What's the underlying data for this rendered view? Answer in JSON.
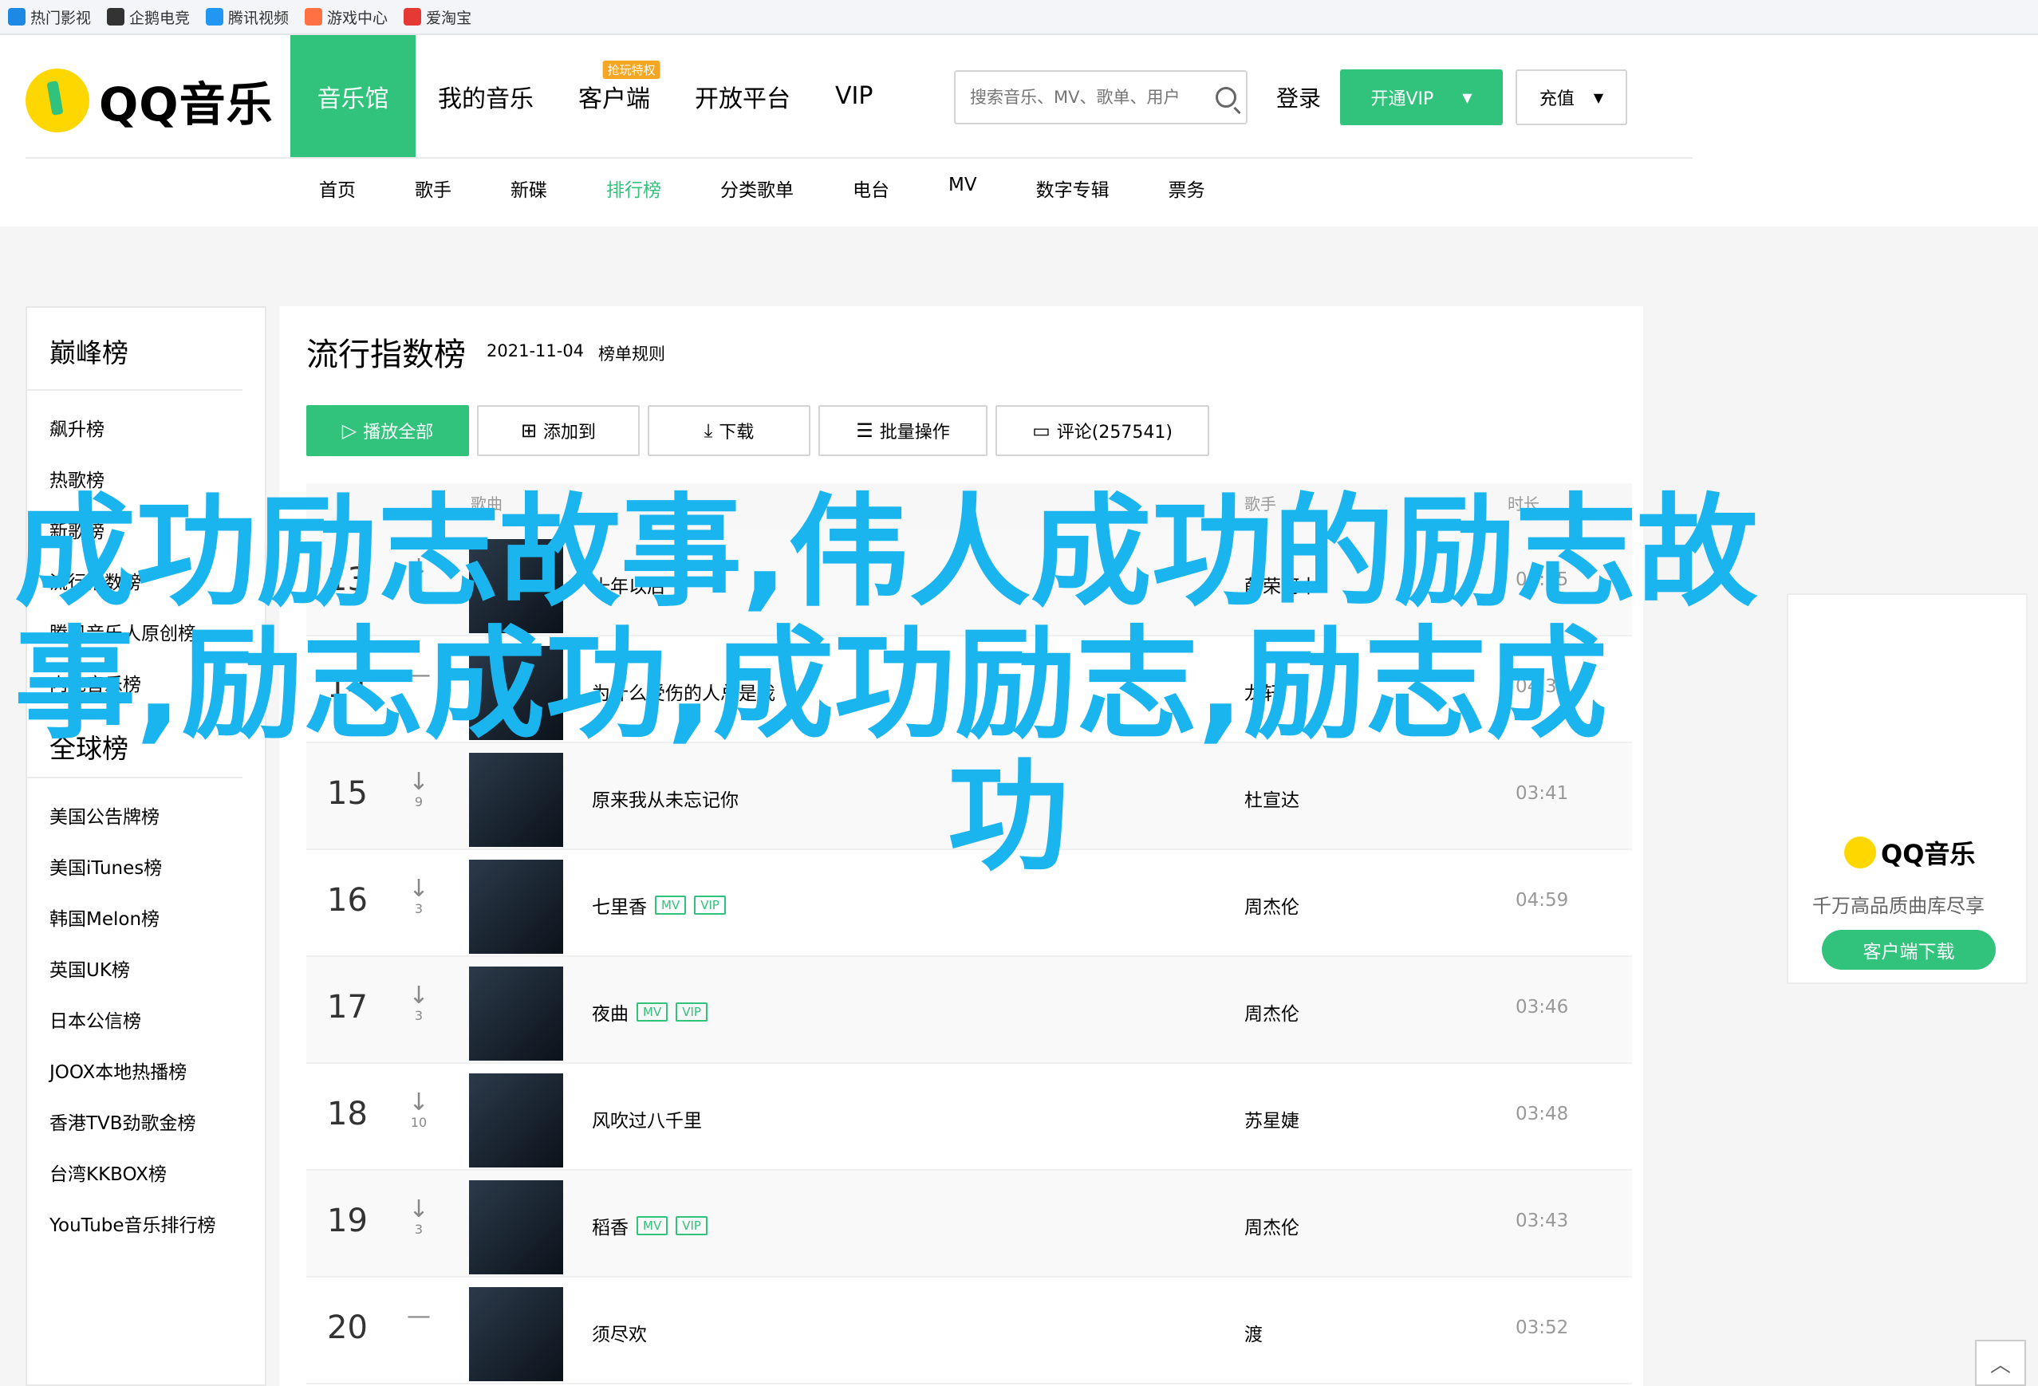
{
  "bookmarks": [
    {
      "label": "热门影视",
      "color": "#1e88e5"
    },
    {
      "label": "企鹅电竞",
      "color": "#333333"
    },
    {
      "label": "腾讯视频",
      "color": "#2196f3"
    },
    {
      "label": "游戏中心",
      "color": "#ff7043"
    },
    {
      "label": "爱淘宝",
      "color": "#e53935"
    }
  ],
  "header": {
    "logo": "QQ音乐",
    "nav": [
      "音乐馆",
      "我的音乐",
      "客户端",
      "开放平台",
      "VIP"
    ],
    "hot_badge": "抢玩特权",
    "search_placeholder": "搜索音乐、MV、歌单、用户",
    "login": "登录",
    "vip_button": "开通VIP",
    "charge_button": "充值",
    "subnav": [
      "首页",
      "歌手",
      "新碟",
      "排行榜",
      "分类歌单",
      "电台",
      "MV",
      "数字专辑",
      "票务"
    ]
  },
  "sidebar": {
    "section1_title": "巅峰榜",
    "section1_items": [
      "飙升榜",
      "热歌榜",
      "新歌榜",
      "流行指数榜",
      "腾讯音乐人原创榜",
      "内地音乐榜"
    ],
    "section2_title": "全球榜",
    "section2_items": [
      "美国公告牌榜",
      "美国iTunes榜",
      "韩国Melon榜",
      "英国UK榜",
      "日本公信榜",
      "JOOX本地热播榜",
      "香港TVB劲歌金榜",
      "台湾KKBOX榜",
      "YouTube音乐排行榜"
    ]
  },
  "main": {
    "title": "流行指数榜",
    "date": "2021-11-04",
    "rule": "榜单规则",
    "toolbar": [
      "播放全部",
      "添加到",
      "下载",
      "批量操作",
      "评论(257541)"
    ],
    "columns": [
      "歌曲",
      "歌手",
      "时长"
    ],
    "rows": [
      {
        "rank": "13",
        "change": "2",
        "song": "十年以后",
        "singer": "薛荣阿木",
        "duration": "05:05",
        "mv": false,
        "vip": false
      },
      {
        "rank": "14",
        "change": "",
        "song": "为什么受伤的人总是我",
        "singer": "龙轩",
        "duration": "04:33",
        "mv": false,
        "vip": false
      },
      {
        "rank": "15",
        "change": "9",
        "song": "原来我从未忘记你",
        "singer": "杜宣达",
        "duration": "03:41",
        "mv": false,
        "vip": false
      },
      {
        "rank": "16",
        "change": "3",
        "song": "七里香",
        "singer": "周杰伦",
        "duration": "04:59",
        "mv": true,
        "vip": true
      },
      {
        "rank": "17",
        "change": "3",
        "song": "夜曲",
        "singer": "周杰伦",
        "duration": "03:46",
        "mv": true,
        "vip": true
      },
      {
        "rank": "18",
        "change": "10",
        "song": "风吹过八千里",
        "singer": "苏星婕",
        "duration": "03:48",
        "mv": false,
        "vip": false
      },
      {
        "rank": "19",
        "change": "3",
        "song": "稻香",
        "singer": "周杰伦",
        "duration": "03:43",
        "mv": true,
        "vip": true
      },
      {
        "rank": "20",
        "change": "",
        "song": "须尽欢",
        "singer": "渡",
        "duration": "03:52",
        "mv": false,
        "vip": false
      }
    ],
    "tag_mv": "MV",
    "tag_vip": "VIP"
  },
  "ad": {
    "logo": "QQ音乐",
    "slogan": "千万高品质曲库尽享",
    "download": "客户端下载"
  },
  "overlay": {
    "line1": "成功励志故事,伟人成功的励志故",
    "line2": "事,励志成功,成功励志,励志成",
    "line3": "功"
  },
  "colors": {
    "accent": "#31c27c",
    "overlay": "#1ab5ef"
  }
}
